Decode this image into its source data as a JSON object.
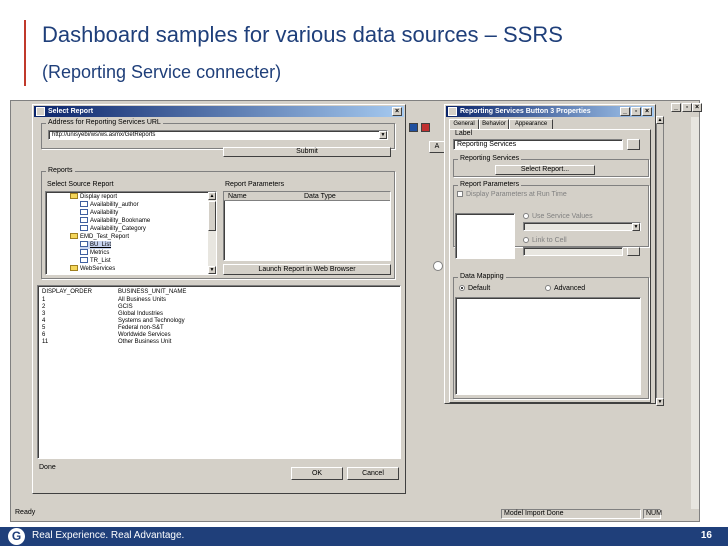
{
  "slide": {
    "title": "Dashboard samples for various data sources – SSRS",
    "subtitle": "(Reporting Service connecter)",
    "footer_tagline": "Real Experience. Real Advantage.",
    "logo_letter": "G",
    "page_number": "16"
  },
  "app": {
    "status_ready": "Ready",
    "status_model": "Model Import Done",
    "status_num": "NUM"
  },
  "select_report": {
    "title": "Select Report",
    "url_group": "Address for Reporting Services URL",
    "url_value": "http://unisyebi/ws/ws.asmx/GetReports",
    "submit_label": "Submit",
    "reports_group": "Reports",
    "select_source_label": "Select Source Report",
    "report_params_label": "Report Parameters",
    "params_columns": [
      "Name",
      "Data Type"
    ],
    "launch_label": "Launch Report in Web Browser",
    "tree": [
      {
        "label": "Display report",
        "kind": "folder",
        "indent": 1
      },
      {
        "label": "Availability_author",
        "kind": "report",
        "indent": 2
      },
      {
        "label": "Availability",
        "kind": "report",
        "indent": 2
      },
      {
        "label": "Availability_Bookname",
        "kind": "report",
        "indent": 2
      },
      {
        "label": "Availability_Category",
        "kind": "report",
        "indent": 2
      },
      {
        "label": "EMD_Test_Report",
        "kind": "folder",
        "indent": 1
      },
      {
        "label": "BU_List",
        "kind": "report",
        "indent": 2
      },
      {
        "label": "Metrics",
        "kind": "report",
        "indent": 2
      },
      {
        "label": "TR_List",
        "kind": "report",
        "indent": 2
      },
      {
        "label": "WebServices",
        "kind": "folder",
        "indent": 1
      }
    ],
    "table_columns": [
      "DISPLAY_ORDER",
      "BUSINESS_UNIT_NAME"
    ],
    "table_rows": [
      [
        "1",
        "All Business Units"
      ],
      [
        "2",
        "GCIS"
      ],
      [
        "3",
        "Global Industries"
      ],
      [
        "4",
        "Systems and Technology"
      ],
      [
        "5",
        "Federal non-S&T"
      ],
      [
        "6",
        "Worldwide Services"
      ],
      [
        "11",
        "Other Business Unit"
      ]
    ],
    "status_text": "Done",
    "ok_label": "OK",
    "cancel_label": "Cancel"
  },
  "properties": {
    "title": "Reporting Services Button 3 Properties",
    "tabs": [
      "General",
      "Behavior",
      "Appearance"
    ],
    "label_group": "Label",
    "label_value": "Reporting Services",
    "rs_group": "Reporting Services",
    "select_report_btn": "Select Report...",
    "params_group": "Report Parameters",
    "display_params": "Display Parameters at Run Time",
    "use_service_values": "Use Service Values",
    "link_to_cell": "Link to Cell",
    "mapping_group": "Data Mapping",
    "default_label": "Default",
    "advanced_label": "Advanced"
  },
  "colors": {
    "slide_blue": "#1f3f7a",
    "accent_red": "#c0392b",
    "window_gray": "#d4d0c8"
  }
}
